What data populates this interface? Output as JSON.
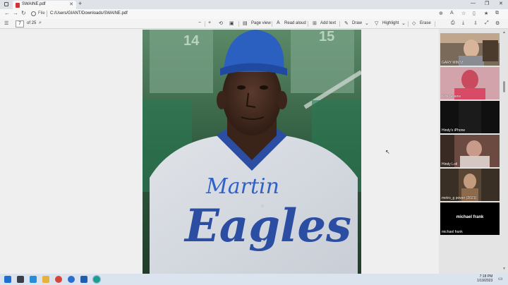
{
  "browser": {
    "tab_title": "SWAINE.pdf",
    "tab_close": "✕",
    "new_tab": "+",
    "address_label": "File",
    "address_url": "C:/Users/GIANT/Downloads/SWAINE.pdf"
  },
  "pdf_toolbar": {
    "page_current": "7",
    "page_total": "of 25",
    "page_view": "Page view",
    "read_aloud": "Read aloud",
    "add_text": "Add text",
    "draw": "Draw",
    "highlight": "Highlight",
    "erase": "Erase"
  },
  "pdf_content": {
    "jersey_numbers": [
      "14",
      "15"
    ],
    "jersey_text": "Eagles",
    "signature": "Martin"
  },
  "participants": [
    {
      "name": "GARY MINTZ",
      "overlay": ""
    },
    {
      "name": "Kick Swaine",
      "overlay": ""
    },
    {
      "name": "Hindy's iPhone",
      "overlay": ""
    },
    {
      "name": "Hindy Lotl",
      "overlay": ""
    },
    {
      "name": "metro_g power (2021)",
      "overlay": ""
    },
    {
      "name": "michael frank",
      "overlay": "michael frank"
    }
  ],
  "taskbar": {
    "time": "7:18 PM",
    "date": "1/19/2023"
  },
  "colors": {
    "pdf_icon": "#d13438",
    "taskbar": "#dbe3ee",
    "jersey_blue": "#2b4ea3"
  }
}
